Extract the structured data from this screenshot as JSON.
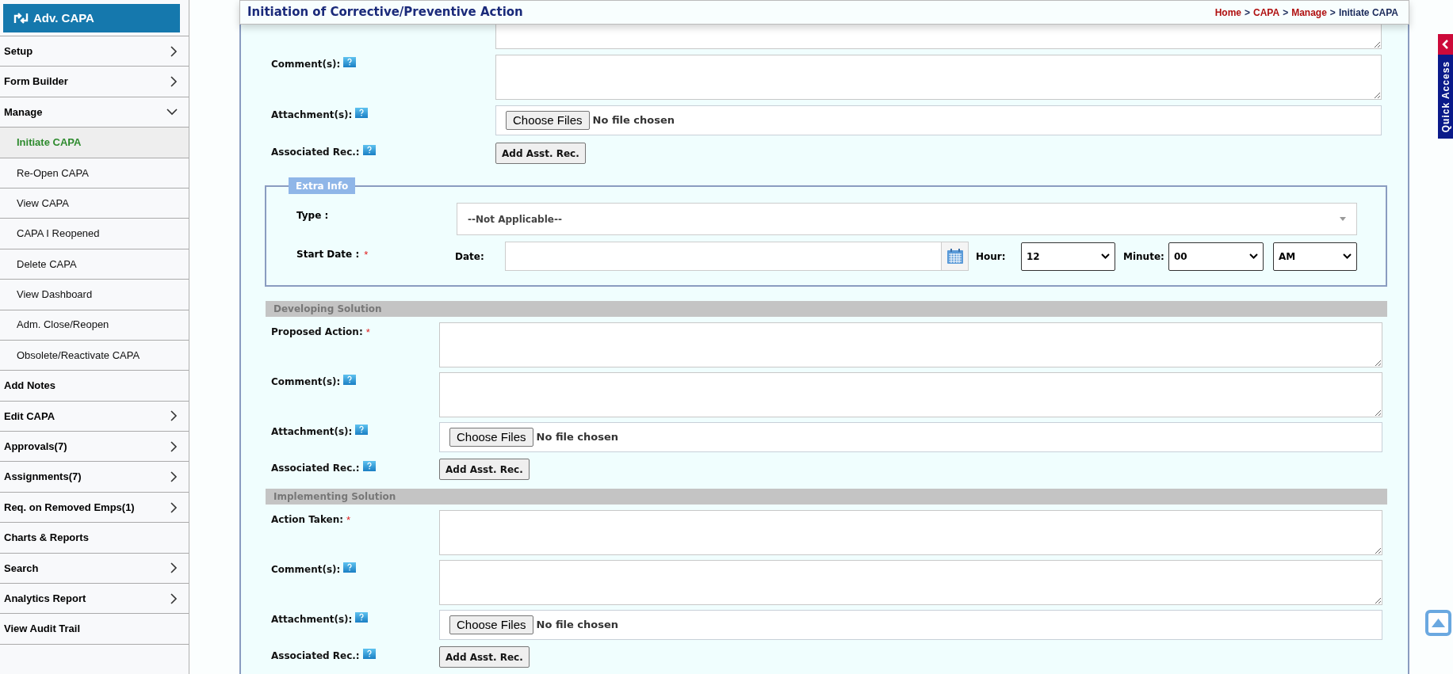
{
  "app_button": {
    "label": "Adv. CAPA"
  },
  "sidebar": {
    "items": [
      {
        "label": "Setup",
        "kind": "menu",
        "expanded": false
      },
      {
        "label": "Form Builder",
        "kind": "menu",
        "expanded": false
      },
      {
        "label": "Manage",
        "kind": "menu",
        "expanded": true,
        "children": [
          {
            "label": "Initiate CAPA",
            "selected": true
          },
          {
            "label": "Re-Open CAPA",
            "selected": false
          },
          {
            "label": "View CAPA",
            "selected": false
          },
          {
            "label": "CAPA I Reopened",
            "selected": false
          },
          {
            "label": "Delete CAPA",
            "selected": false
          },
          {
            "label": "View Dashboard",
            "selected": false
          },
          {
            "label": "Adm. Close/Reopen",
            "selected": false
          },
          {
            "label": "Obsolete/Reactivate CAPA",
            "selected": false
          }
        ]
      },
      {
        "label": "Add Notes",
        "kind": "link"
      },
      {
        "label": "Edit CAPA",
        "kind": "menu",
        "expanded": false
      },
      {
        "label": "Approvals(7)",
        "kind": "menu",
        "expanded": false
      },
      {
        "label": "Assignments(7)",
        "kind": "menu",
        "expanded": false
      },
      {
        "label": "Req. on Removed Emps(1)",
        "kind": "menu",
        "expanded": false
      },
      {
        "label": "Charts & Reports",
        "kind": "link"
      },
      {
        "label": "Search",
        "kind": "menu",
        "expanded": false
      },
      {
        "label": "Analytics Report",
        "kind": "menu",
        "expanded": false
      },
      {
        "label": "View Audit Trail",
        "kind": "link"
      }
    ]
  },
  "header": {
    "title": "Initiation of Corrective/Preventive Action",
    "breadcrumb": [
      {
        "label": "Home",
        "link": true,
        "separator": ">"
      },
      {
        "label": "CAPA",
        "link": true,
        "separator": ">"
      },
      {
        "label": "Manage",
        "link": true,
        "separator": ">"
      },
      {
        "label": "Initiate CAPA",
        "link": false
      }
    ]
  },
  "top_fields": [
    {
      "kind": "textarea",
      "cut": true
    },
    {
      "kind": "textarea",
      "label": "Comment(s):",
      "help": true
    },
    {
      "kind": "file",
      "label": "Attachment(s):",
      "help": true,
      "button": "Choose Files",
      "status": "No file chosen"
    },
    {
      "kind": "button",
      "label": "Associated Rec.:",
      "help": true,
      "button": "Add Asst. Rec."
    }
  ],
  "extra_info": {
    "legend": "Extra Info",
    "type_label": "Type :",
    "type_value": "--Not Applicable--",
    "start_label": "Start Date :",
    "start_mark": "*",
    "date_label": "Date:",
    "hour_label": "Hour:",
    "hour": "12",
    "minute_label": "Minute:",
    "minute": "00",
    "period": "AM"
  },
  "sections": [
    {
      "title": "Developing Solution",
      "fields": [
        {
          "kind": "textarea",
          "label": "Proposed Action:",
          "mark": "*"
        },
        {
          "kind": "textarea",
          "label": "Comment(s):",
          "help": true
        },
        {
          "kind": "file",
          "label": "Attachment(s):",
          "help": true,
          "button": "Choose Files",
          "status": "No file chosen"
        },
        {
          "kind": "button",
          "label": "Associated Rec.:",
          "help": true,
          "button": "Add Asst. Rec."
        }
      ]
    },
    {
      "title": "Implementing Solution",
      "fields": [
        {
          "kind": "textarea",
          "label": "Action Taken:",
          "mark": "*"
        },
        {
          "kind": "textarea",
          "label": "Comment(s):",
          "help": true
        },
        {
          "kind": "file",
          "label": "Attachment(s):",
          "help": true,
          "button": "Choose Files",
          "status": "No file chosen"
        },
        {
          "kind": "button",
          "label": "Associated Rec.:",
          "help": true,
          "button": "Add Asst. Rec."
        }
      ]
    }
  ],
  "quick_access": {
    "label": "Quick Access"
  }
}
